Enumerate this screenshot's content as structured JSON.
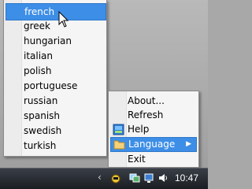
{
  "language_menu": {
    "items": [
      {
        "label": "french",
        "selected": true
      },
      {
        "label": "greek",
        "selected": false
      },
      {
        "label": "hungarian",
        "selected": false
      },
      {
        "label": "italian",
        "selected": false
      },
      {
        "label": "polish",
        "selected": false
      },
      {
        "label": "portuguese",
        "selected": false
      },
      {
        "label": "russian",
        "selected": false
      },
      {
        "label": "spanish",
        "selected": false
      },
      {
        "label": "swedish",
        "selected": false
      },
      {
        "label": "turkish",
        "selected": false
      }
    ]
  },
  "tray_menu": {
    "items": [
      {
        "label": "About...",
        "icon": null
      },
      {
        "label": "Refresh",
        "icon": null
      },
      {
        "label": "Help",
        "icon": "help-icon"
      },
      {
        "label": "Language",
        "icon": "folder-icon",
        "submenu": true
      },
      {
        "label": "Exit",
        "icon": null
      }
    ]
  },
  "taskbar": {
    "clock": "10:47",
    "icons": [
      "show-hidden-chevron-icon",
      "tray-app-icon",
      "network-icon",
      "monitor-icon",
      "volume-icon"
    ]
  },
  "colors": {
    "highlight": "#3d8ee6",
    "menu_bg": "#f5f5f5",
    "taskbar": "#1a1d22"
  }
}
